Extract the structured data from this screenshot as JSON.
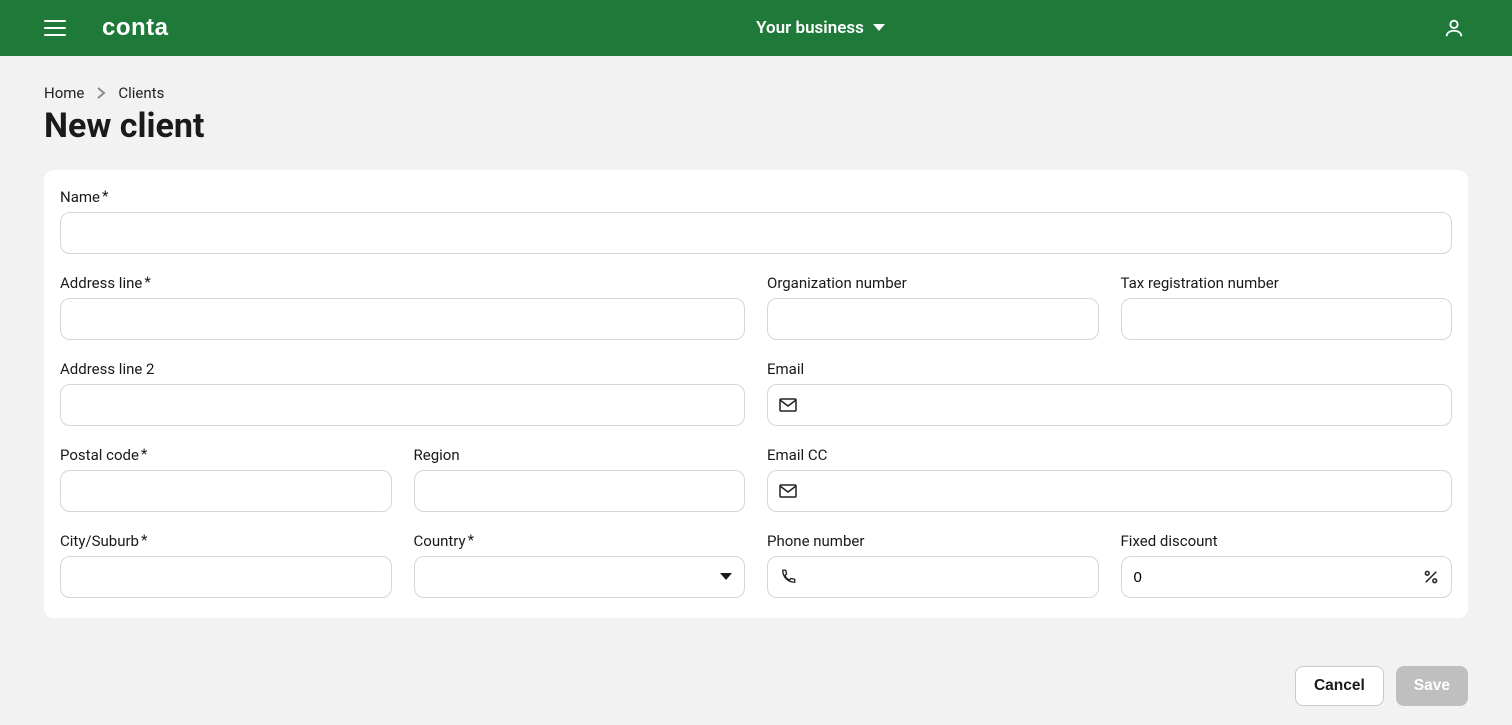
{
  "header": {
    "brand": "conta",
    "business_selector": "Your business"
  },
  "breadcrumb": {
    "home": "Home",
    "clients": "Clients"
  },
  "page": {
    "title": "New client"
  },
  "labels": {
    "name": "Name",
    "address_line": "Address line",
    "org_number": "Organization number",
    "tax_number": "Tax registration number",
    "address_line_2": "Address line 2",
    "email": "Email",
    "postal_code": "Postal code",
    "region": "Region",
    "email_cc": "Email CC",
    "city": "City/Suburb",
    "country": "Country",
    "phone": "Phone number",
    "discount": "Fixed discount",
    "required_mark": "*"
  },
  "values": {
    "name": "",
    "address_line": "",
    "org_number": "",
    "tax_number": "",
    "address_line_2": "",
    "email": "",
    "postal_code": "",
    "region": "",
    "email_cc": "",
    "city": "",
    "country": "",
    "phone": "",
    "discount": "0"
  },
  "buttons": {
    "cancel": "Cancel",
    "save": "Save"
  }
}
